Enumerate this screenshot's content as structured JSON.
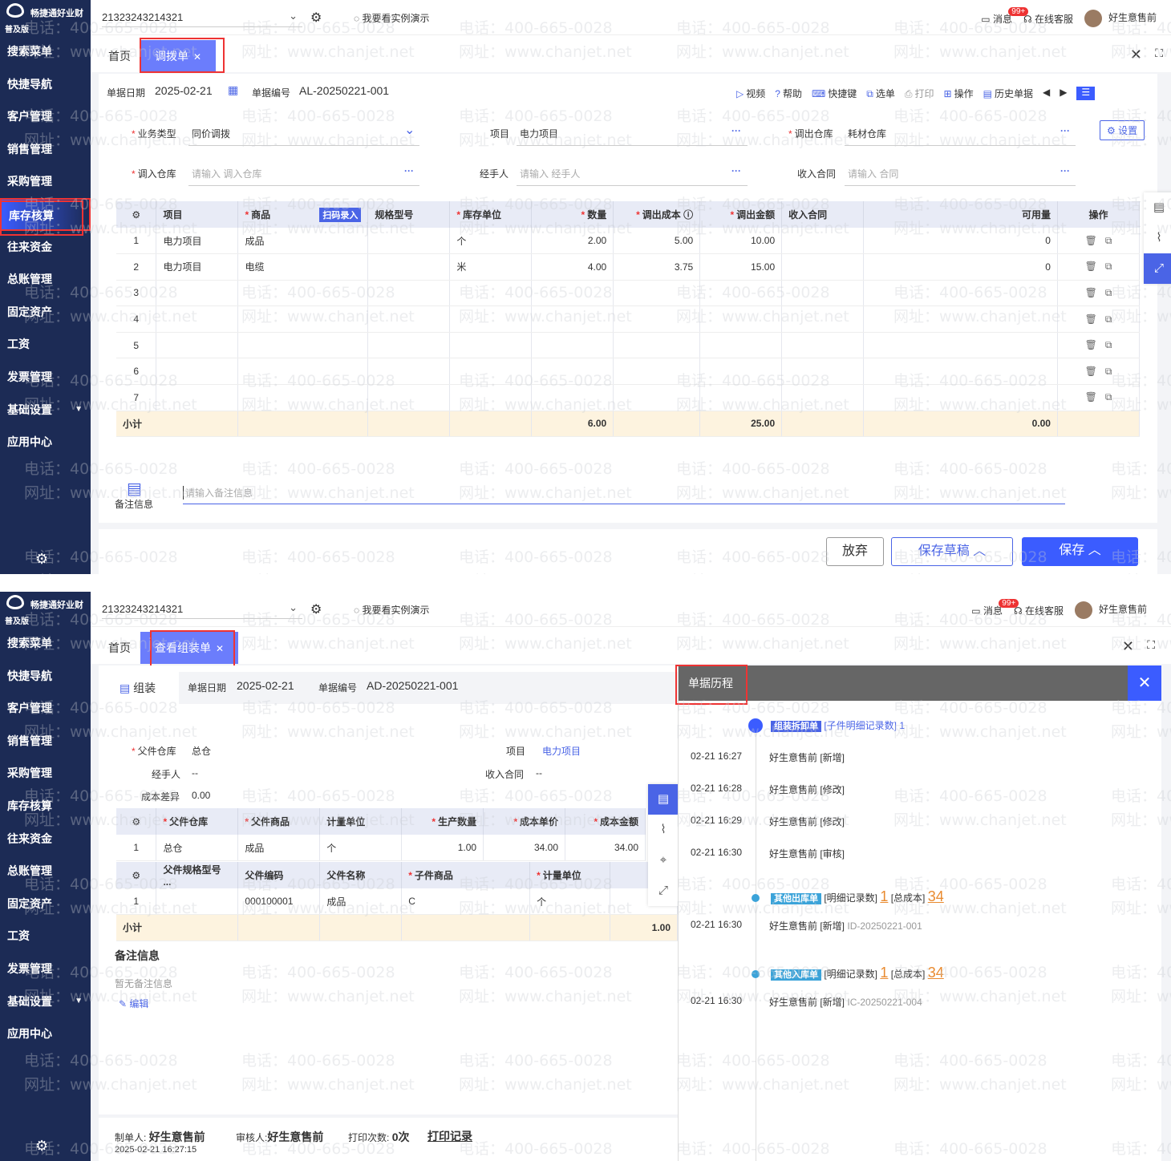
{
  "app": {
    "brand": "畅捷通好业财",
    "edition": "普及版",
    "account": "21323243214321",
    "demo": "我要看实例演示",
    "messages": "消息",
    "badge": "99+",
    "service": "在线客服",
    "user": "好生意售前"
  },
  "watermark": {
    "phone": "电话：400-665-0028",
    "site": "网址：www.chanjet.net"
  },
  "menu": [
    "搜索菜单",
    "快捷导航",
    "客户管理",
    "销售管理",
    "采购管理",
    "库存核算",
    "往来资金",
    "总账管理",
    "固定资产",
    "工资",
    "发票管理",
    "基础设置",
    "应用中心"
  ],
  "s1": {
    "tabs": {
      "home": "首页",
      "current": "调拨单"
    },
    "date_label": "单据日期",
    "date": "2025-02-21",
    "no_label": "单据编号",
    "no": "AL-20250221-001",
    "tools": [
      "视频",
      "帮助",
      "快捷键",
      "选单",
      "打印",
      "操作",
      "历史单据"
    ],
    "settings": "设置",
    "fields": {
      "biz_type_label": "业务类型",
      "biz_type": "同价调拨",
      "project_label": "项目",
      "project": "电力项目",
      "out_wh_label": "调出仓库",
      "out_wh": "耗材仓库",
      "in_wh_label": "调入仓库",
      "in_wh_ph": "请输入 调入仓库",
      "handler_label": "经手人",
      "handler_ph": "请输入 经手人",
      "contract_label": "收入合同",
      "contract_ph": "请输入 合同"
    },
    "table": {
      "scan": "扫码录入",
      "headers": [
        "项目",
        "商品",
        "规格型号",
        "库存单位",
        "数量",
        "调出成本",
        "调出金额",
        "收入合同",
        "可用量",
        "操作"
      ],
      "rows": [
        [
          "1",
          "电力项目",
          "成品",
          "",
          "个",
          "2.00",
          "5.00",
          "10.00",
          "",
          "0"
        ],
        [
          "2",
          "电力项目",
          "电缆",
          "",
          "米",
          "4.00",
          "3.75",
          "15.00",
          "",
          "0"
        ],
        [
          "3",
          "",
          "",
          "",
          "",
          "",
          "",
          "",
          "",
          ""
        ],
        [
          "4",
          "",
          "",
          "",
          "",
          "",
          "",
          "",
          "",
          ""
        ],
        [
          "5",
          "",
          "",
          "",
          "",
          "",
          "",
          "",
          "",
          ""
        ],
        [
          "6",
          "",
          "",
          "",
          "",
          "",
          "",
          "",
          "",
          ""
        ],
        [
          "7",
          "",
          "",
          "",
          "",
          "",
          "",
          "",
          "",
          ""
        ]
      ],
      "subtotal": {
        "label": "小计",
        "qty": "6.00",
        "amount": "25.00",
        "avail": "0.00"
      }
    },
    "remark_label": "备注信息",
    "remark_ph": "请输入备注信息",
    "buttons": {
      "discard": "放弃",
      "draft": "保存草稿",
      "save": "保存"
    }
  },
  "s2": {
    "tabs": {
      "home": "首页",
      "current": "查看组装单"
    },
    "type": "组装",
    "date_label": "单据日期",
    "date": "2025-02-21",
    "no_label": "单据编号",
    "no": "AD-20250221-001",
    "fields": {
      "parent_wh_label": "父件仓库",
      "parent_wh": "总仓",
      "project_label": "项目",
      "project": "电力项目",
      "handler_label": "经手人",
      "handler": "--",
      "contract_label": "收入合同",
      "contract": "--",
      "diff_label": "成本差异",
      "diff": "0.00"
    },
    "parent_table": {
      "headers": [
        "父件仓库",
        "父件商品",
        "计量单位",
        "生产数量",
        "成本单价",
        "成本金额"
      ],
      "row": [
        "1",
        "总仓",
        "成品",
        "个",
        "1.00",
        "34.00",
        "34.00"
      ]
    },
    "child_table": {
      "headers": [
        "父件规格型号 ...",
        "父件编码",
        "父件名称",
        "子件商品",
        "计量单位"
      ],
      "row": [
        "1",
        "",
        "000100001",
        "成品",
        "C",
        "个"
      ],
      "subtotal": "小计",
      "subtotal_val": "1.00"
    },
    "remark_title": "备注信息",
    "remark_empty": "暂无备注信息",
    "edit": "编辑",
    "footer": {
      "maker_label": "制单人:",
      "maker": "好生意售前",
      "auditor_label": "审核人:",
      "auditor": "好生意售前",
      "print_label": "打印次数:",
      "print_count": "0次",
      "print_rec": "打印记录",
      "time": "2025-02-21 16:27:15"
    },
    "history": {
      "title": "单据历程",
      "group1": {
        "tag": "组装拆卸单",
        "detail": "[子件明细记录数] 1"
      },
      "entries": [
        {
          "time": "02-21 16:27",
          "text": "好生意售前 [新增]"
        },
        {
          "time": "02-21 16:28",
          "text": "好生意售前 [修改]"
        },
        {
          "time": "02-21 16:29",
          "text": "好生意售前 [修改]"
        },
        {
          "time": "02-21 16:30",
          "text": "好生意售前 [审核]"
        }
      ],
      "group2": {
        "tag": "其他出库单",
        "detail": "[明细记录数]",
        "count": "1",
        "cost_label": "[总成本]",
        "cost": "34",
        "time": "02-21 16:30",
        "text": "好生意售前 [新增]",
        "id": "ID-20250221-001"
      },
      "group3": {
        "tag": "其他入库单",
        "detail": "[明细记录数]",
        "count": "1",
        "cost_label": "[总成本]",
        "cost": "34",
        "time": "02-21 16:30",
        "text": "好生意售前 [新增]",
        "id": "IC-20250221-004"
      }
    }
  }
}
